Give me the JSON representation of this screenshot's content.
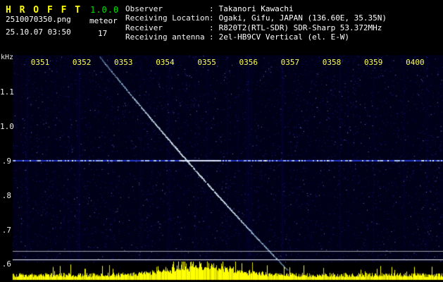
{
  "app": {
    "title": "H R O F F T",
    "version": "1.0.0",
    "filename": "2510070350.png",
    "mode": "meteor",
    "datetime": "25.10.07 03:50",
    "count": "17"
  },
  "info": {
    "separator": ":",
    "rows": [
      {
        "label": "Observer",
        "value": "Takanori Kawachi"
      },
      {
        "label": "Receiving Location",
        "value": "Ogaki, Gifu, JAPAN (136.60E, 35.35N)"
      },
      {
        "label": "Receiver",
        "value": "R820T2(RTL-SDR) SDR-Sharp 53.372MHz"
      },
      {
        "label": "Receiving antenna",
        "value": "2el-HB9CV Vertical (el. E-W)"
      }
    ]
  },
  "chart_data": {
    "type": "heatmap",
    "description": "10-minute radio meteor spectrogram (waterfall) with yellow signal-level strip at bottom",
    "ylabel": "kHz",
    "x_ticks": [
      "0351",
      "0352",
      "0353",
      "0354",
      "0355",
      "0356",
      "0357",
      "0358",
      "0359",
      "0400"
    ],
    "y_ticks": [
      {
        "label": "1.1",
        "khz": 1.1
      },
      {
        "label": "1.0",
        "khz": 1.0
      },
      {
        "label": ".9",
        "khz": 0.9
      },
      {
        "label": ".8",
        "khz": 0.8
      },
      {
        "label": ".7",
        "khz": 0.7
      },
      {
        "label": ".6",
        "khz": 0.6
      }
    ],
    "y_range_khz": [
      0.58,
      1.21
    ],
    "carrier_line_khz": 0.9,
    "meteor_trace": {
      "start": {
        "time": "0352.4",
        "khz": 1.2
      },
      "end": {
        "time": "0356.9",
        "khz": 0.58
      },
      "shape": "descending doppler trail, nearly straight, slightly flattening"
    },
    "colors": {
      "background": "#000016",
      "noise": "#2020b4",
      "carrier_line": "#3a50e0",
      "meteor_trace": "#9fd4ff",
      "time_labels": "#ffff55",
      "freq_labels": "#e8e8e8",
      "signal_strip": "#ffff00"
    },
    "grid": "off",
    "legend": "none"
  }
}
